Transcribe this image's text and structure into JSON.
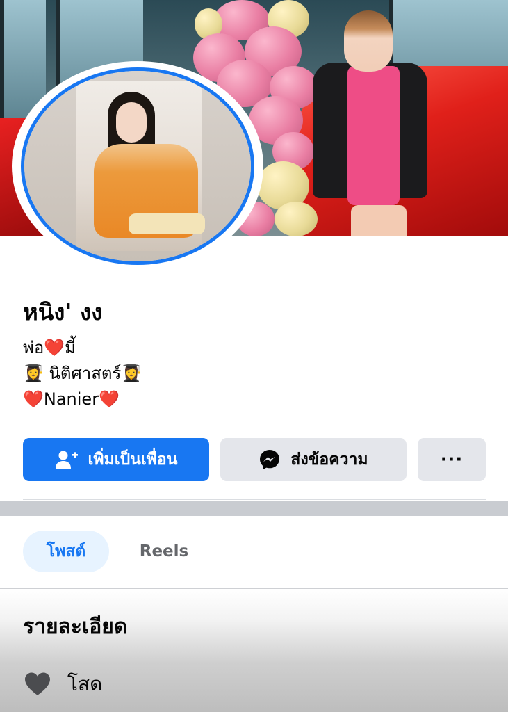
{
  "profile": {
    "name": "หนิง' งง",
    "bio": [
      "พ่อ❤️มี้",
      "👩‍🎓 นิติศาสตร์👩‍🎓",
      "❤️Nanier❤️"
    ]
  },
  "actions": {
    "add_friend_label": "เพิ่มเป็นเพื่อน",
    "message_label": "ส่งข้อความ",
    "more_label": "···"
  },
  "tabs": [
    {
      "label": "โพสต์",
      "active": true
    },
    {
      "label": "Reels",
      "active": false
    }
  ],
  "details": {
    "title": "รายละเอียด",
    "relationship": "โสด"
  },
  "colors": {
    "accent": "#1877f2",
    "secondary_button": "#e4e6eb",
    "active_tab_bg": "#e7f3ff"
  },
  "icons": {
    "add_friend": "add-friend-icon",
    "messenger": "messenger-icon",
    "relationship": "heart-icon"
  }
}
